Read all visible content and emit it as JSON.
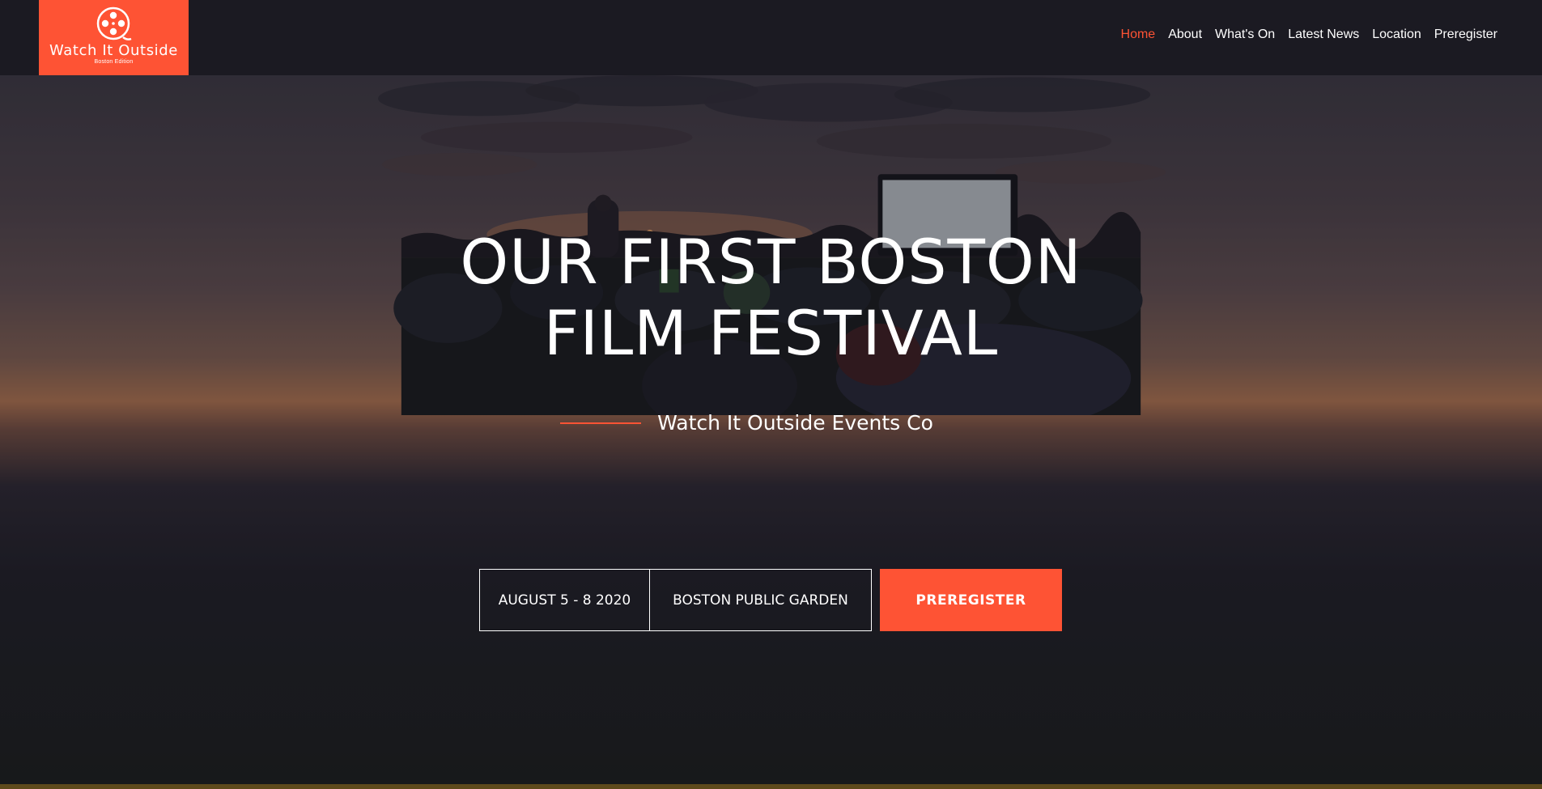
{
  "brand": {
    "name": "Watch It Outside",
    "edition": "Boston Edition",
    "logo_icon": "film-reel-icon",
    "accent_color": "#fe5334",
    "header_bg": "#1b1a22"
  },
  "nav": {
    "items": [
      {
        "label": "Home",
        "active": true
      },
      {
        "label": "About",
        "active": false
      },
      {
        "label": "What's On",
        "active": false
      },
      {
        "label": "Latest News",
        "active": false
      },
      {
        "label": "Location",
        "active": false
      },
      {
        "label": "Preregister",
        "active": false
      }
    ]
  },
  "hero": {
    "title_line1": "OUR FIRST BOSTON",
    "title_line2": "FILM FESTIVAL",
    "subtitle": "Watch It Outside Events Co",
    "date": "AUGUST 5 - 8 2020",
    "location": "BOSTON PUBLIC GARDEN",
    "cta_label": "PREREGISTER"
  }
}
